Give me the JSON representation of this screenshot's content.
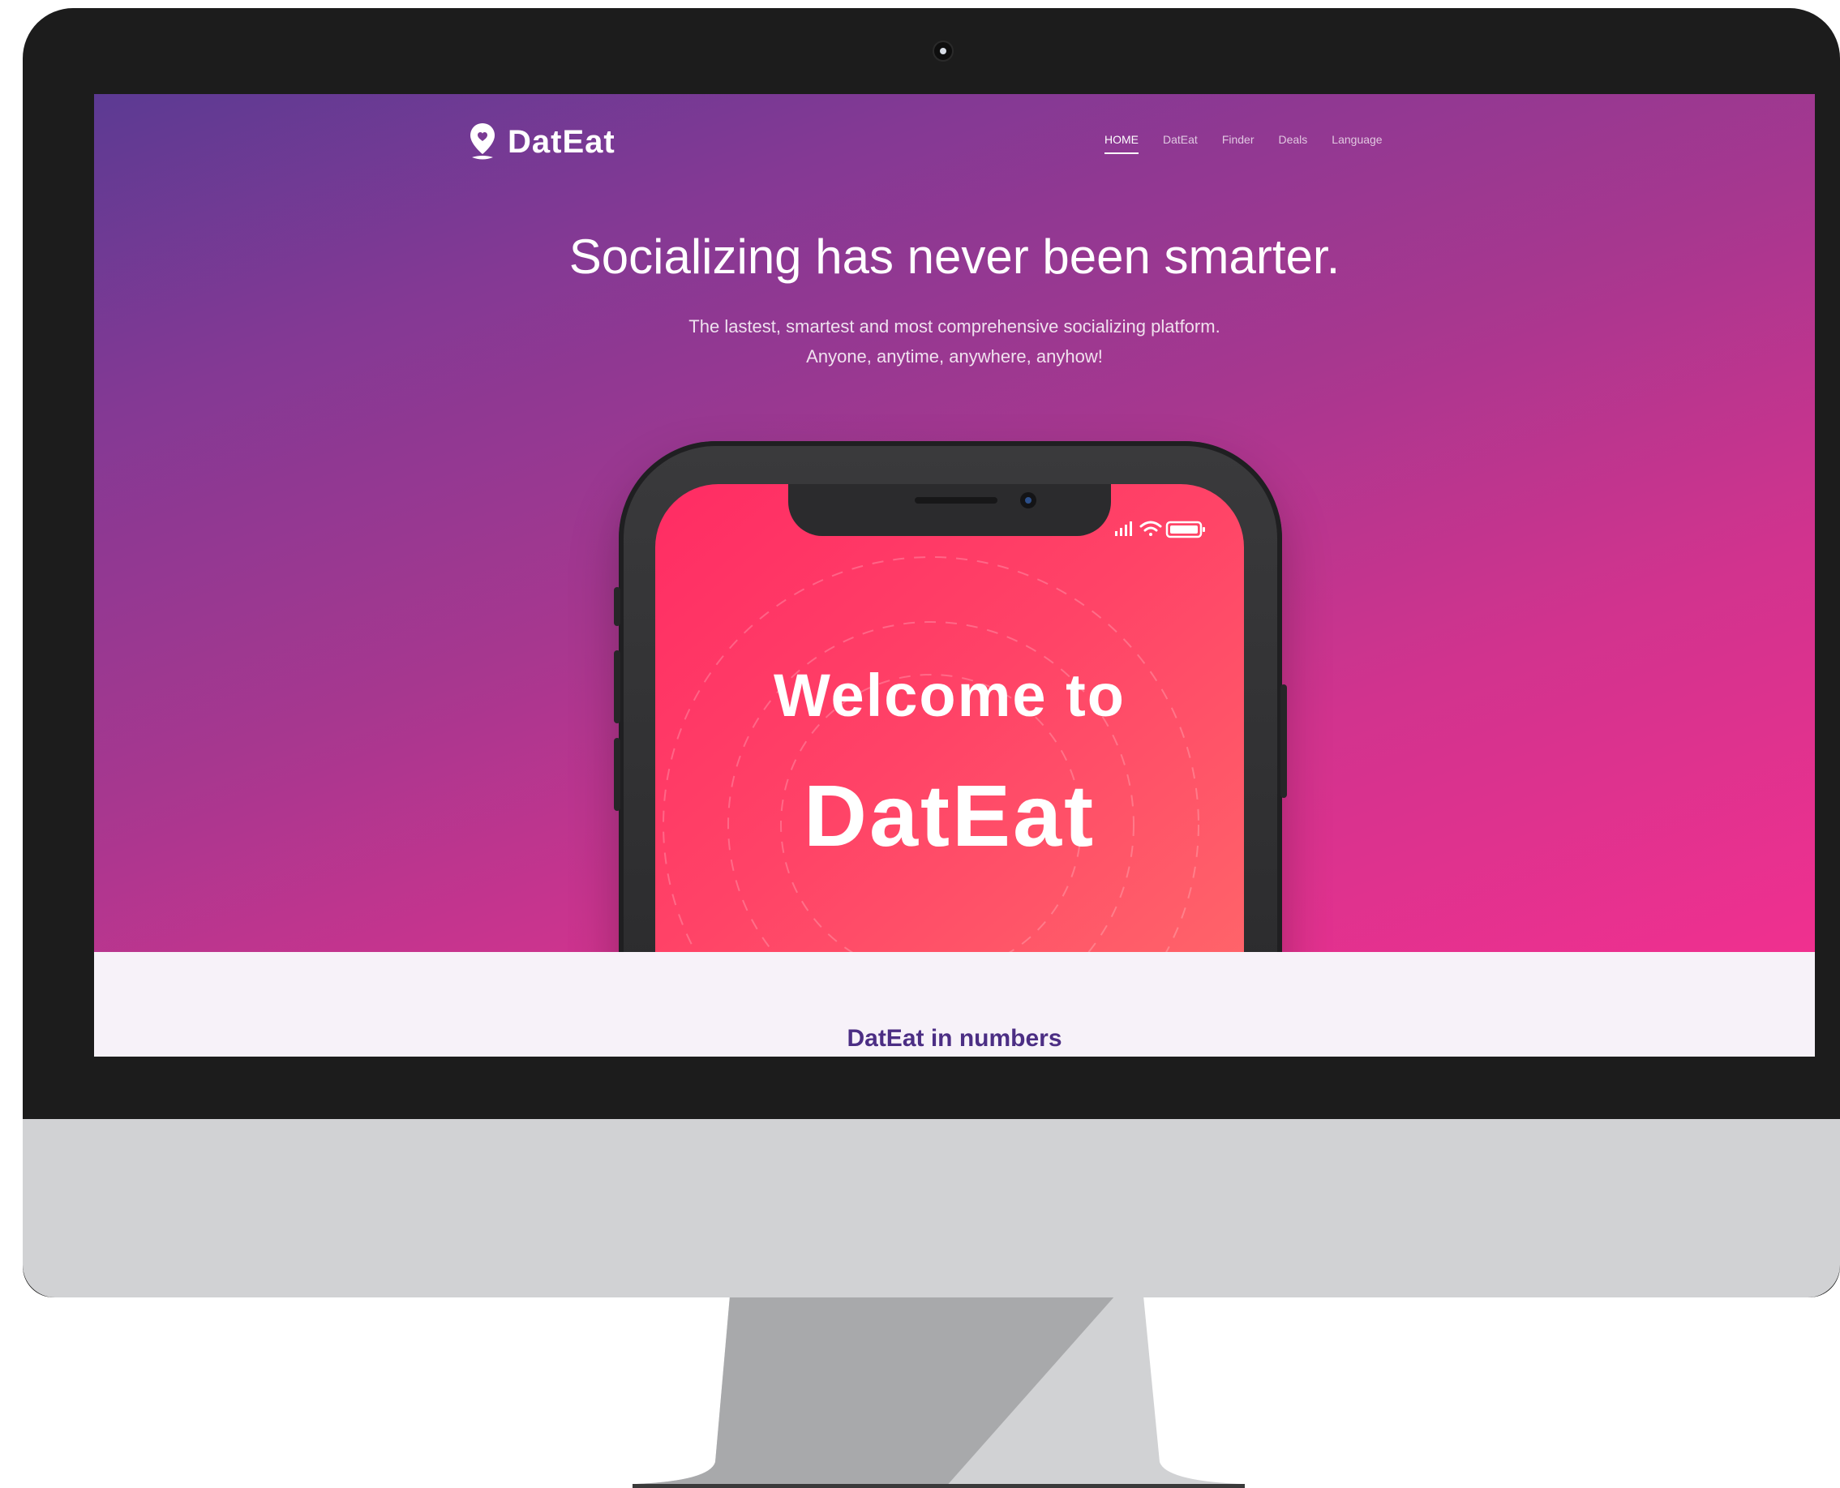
{
  "brand": {
    "name": "DatEat",
    "logo_icon": "map-pin-heart-icon"
  },
  "nav": {
    "items": [
      {
        "label": "HOME",
        "active": true
      },
      {
        "label": "DatEat",
        "active": false
      },
      {
        "label": "Finder",
        "active": false
      },
      {
        "label": "Deals",
        "active": false
      },
      {
        "label": "Language",
        "active": false
      }
    ]
  },
  "hero": {
    "title": "Socializing has never been smarter.",
    "subtitle_line1": "The lastest, smartest and most comprehensive socializing platform.",
    "subtitle_line2": "Anyone, anytime, anywhere, anyhow!"
  },
  "phone": {
    "welcome_line1": "Welcome to",
    "welcome_line2": "DatEat",
    "status_icons": [
      "signal-icon",
      "wifi-icon",
      "battery-icon"
    ]
  },
  "numbers": {
    "title": "DatEat in numbers"
  },
  "colors": {
    "gradient_start": "#5c3a93",
    "gradient_end": "#f0308f",
    "phone_screen": "#ff3c66",
    "numbers_title": "#4c2e84",
    "section_bg": "#f7f2f9"
  }
}
